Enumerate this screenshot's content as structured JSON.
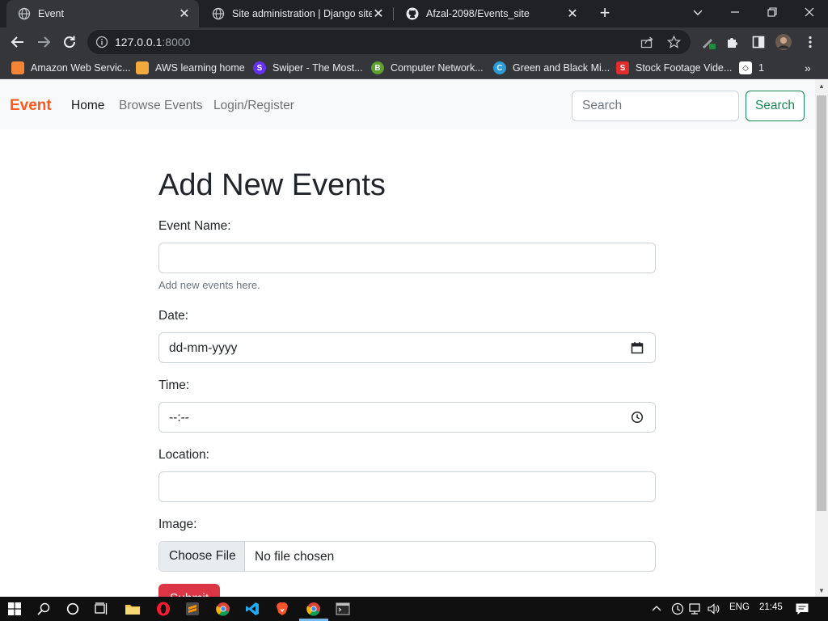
{
  "browser": {
    "tabs": [
      {
        "title": "Event",
        "active": true,
        "icon": "globe-icon"
      },
      {
        "title": "Site administration | Django site",
        "active": false,
        "icon": "globe-icon"
      },
      {
        "title": "Afzal-2098/Events_site",
        "active": false,
        "icon": "github-icon"
      }
    ],
    "newtab_label": "+",
    "url_host": "127.0.0.1",
    "url_port": ":8000",
    "bookmarks": [
      {
        "label": "Amazon Web Servic...",
        "icon": "aws-icon",
        "color": "#f58536"
      },
      {
        "label": "AWS learning home",
        "icon": "box-icon",
        "color": "#f2a93b"
      },
      {
        "label": "Swiper - The Most...",
        "icon": "swiper-icon",
        "color": "#6332f6"
      },
      {
        "label": "Computer Network...",
        "icon": "b-icon",
        "color": "#5aa12f"
      },
      {
        "label": "Green and Black Mi...",
        "icon": "canva-icon",
        "color": "#2a9bd8"
      },
      {
        "label": "Stock Footage Vide...",
        "icon": "stock-icon",
        "color": "#e32b2b"
      },
      {
        "label": "1",
        "icon": "codepen-icon",
        "color": "#ffffff"
      }
    ],
    "bookmarks_overflow": "»"
  },
  "site": {
    "brand": "Event",
    "nav": [
      {
        "label": "Home",
        "active": true
      },
      {
        "label": "Browse Events",
        "active": false
      },
      {
        "label": "Login/Register",
        "active": false
      }
    ],
    "search_placeholder": "Search",
    "search_button": "Search"
  },
  "form": {
    "title": "Add New Events",
    "event_name_label": "Event Name:",
    "event_name_value": "",
    "event_name_help": "Add new events here.",
    "date_label": "Date:",
    "date_value": "dd-mm-yyyy",
    "time_label": "Time:",
    "time_value": "--:--",
    "location_label": "Location:",
    "location_value": "",
    "image_label": "Image:",
    "file_button": "Choose File",
    "file_status": "No file chosen",
    "submit_label": "Submit"
  },
  "taskbar": {
    "language": "ENG",
    "time": "21:45"
  },
  "colors": {
    "brand": "#fd5a1e",
    "search_outline": "#198754",
    "submit": "#dc3545"
  }
}
